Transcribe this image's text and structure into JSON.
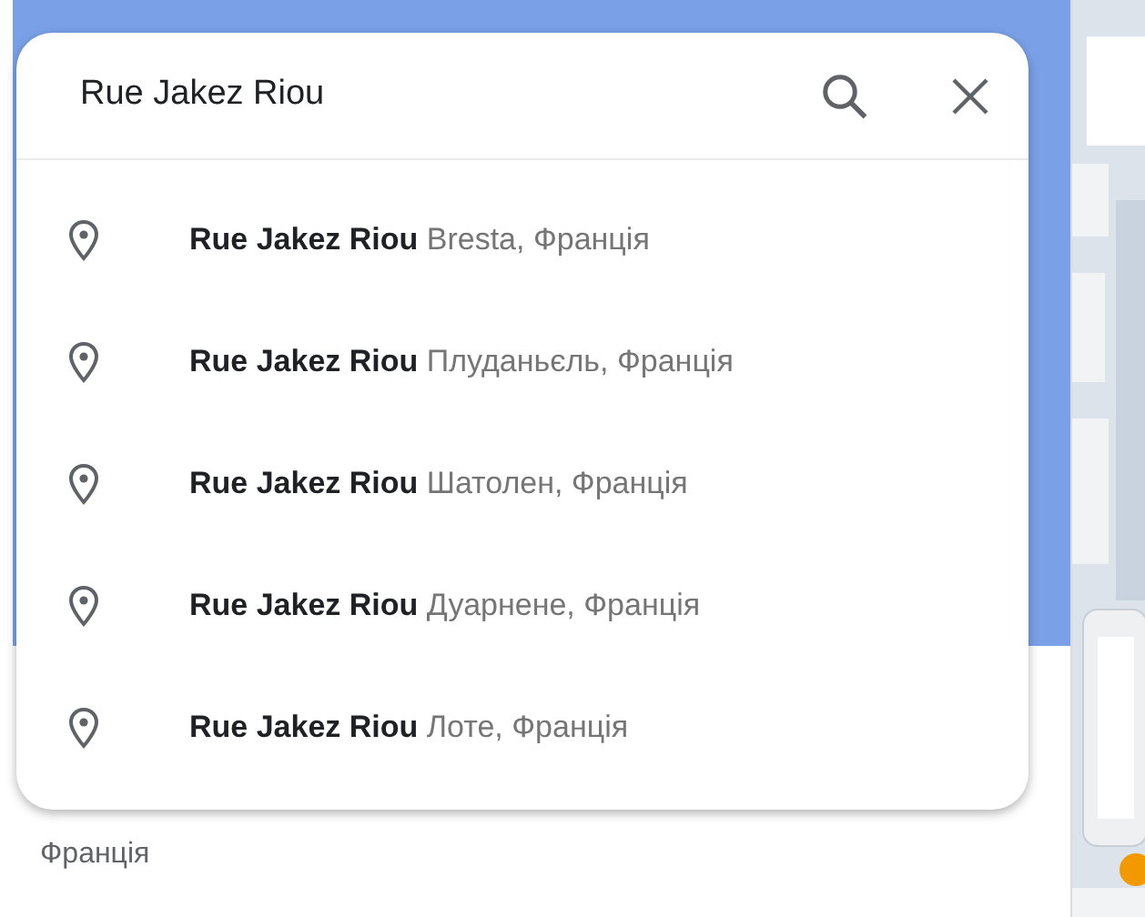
{
  "search": {
    "value": "Rue Jakez Riou"
  },
  "suggestions": [
    {
      "name": "Rue Jakez Riou",
      "place": "Bresta, Франція"
    },
    {
      "name": "Rue Jakez Riou",
      "place": "Плуданьєль, Франція"
    },
    {
      "name": "Rue Jakez Riou",
      "place": "Шатолен, Франція"
    },
    {
      "name": "Rue Jakez Riou",
      "place": "Дуарнене, Франція"
    },
    {
      "name": "Rue Jakez Riou",
      "place": "Лоте, Франція"
    }
  ],
  "panel": {
    "subtitle": "Франція"
  }
}
